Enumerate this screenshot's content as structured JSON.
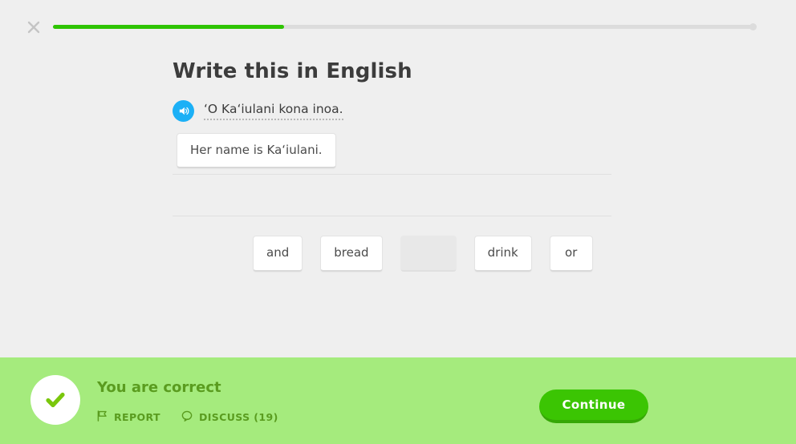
{
  "header": {
    "close_icon": "close-icon",
    "progress": {
      "percent": 33,
      "fill_color": "#2ec402",
      "track_color": "#dcdcdc"
    }
  },
  "challenge": {
    "title": "Write this in English",
    "speaker_icon": "speaker-icon",
    "speaker_color": "#1cb0f6",
    "prompt_text": "ʻO Kaʻiulani kona inoa.",
    "answer": "Her name is Kaʻiulani."
  },
  "word_bank": {
    "tiles": [
      {
        "label": "and",
        "used": false
      },
      {
        "label": "bread",
        "used": false
      },
      {
        "label": "",
        "used": true
      },
      {
        "label": "drink",
        "used": false
      },
      {
        "label": "or",
        "used": false
      }
    ]
  },
  "feedback": {
    "status_icon": "check-icon",
    "title": "You are correct",
    "background_color": "#a5eb7d",
    "text_color": "#5a9c1f",
    "report": {
      "icon": "flag-icon",
      "label": "REPORT"
    },
    "discuss": {
      "icon": "speech-bubble-icon",
      "label": "DISCUSS (19)"
    },
    "continue_label": "Continue",
    "continue_color": "#3bc503"
  }
}
